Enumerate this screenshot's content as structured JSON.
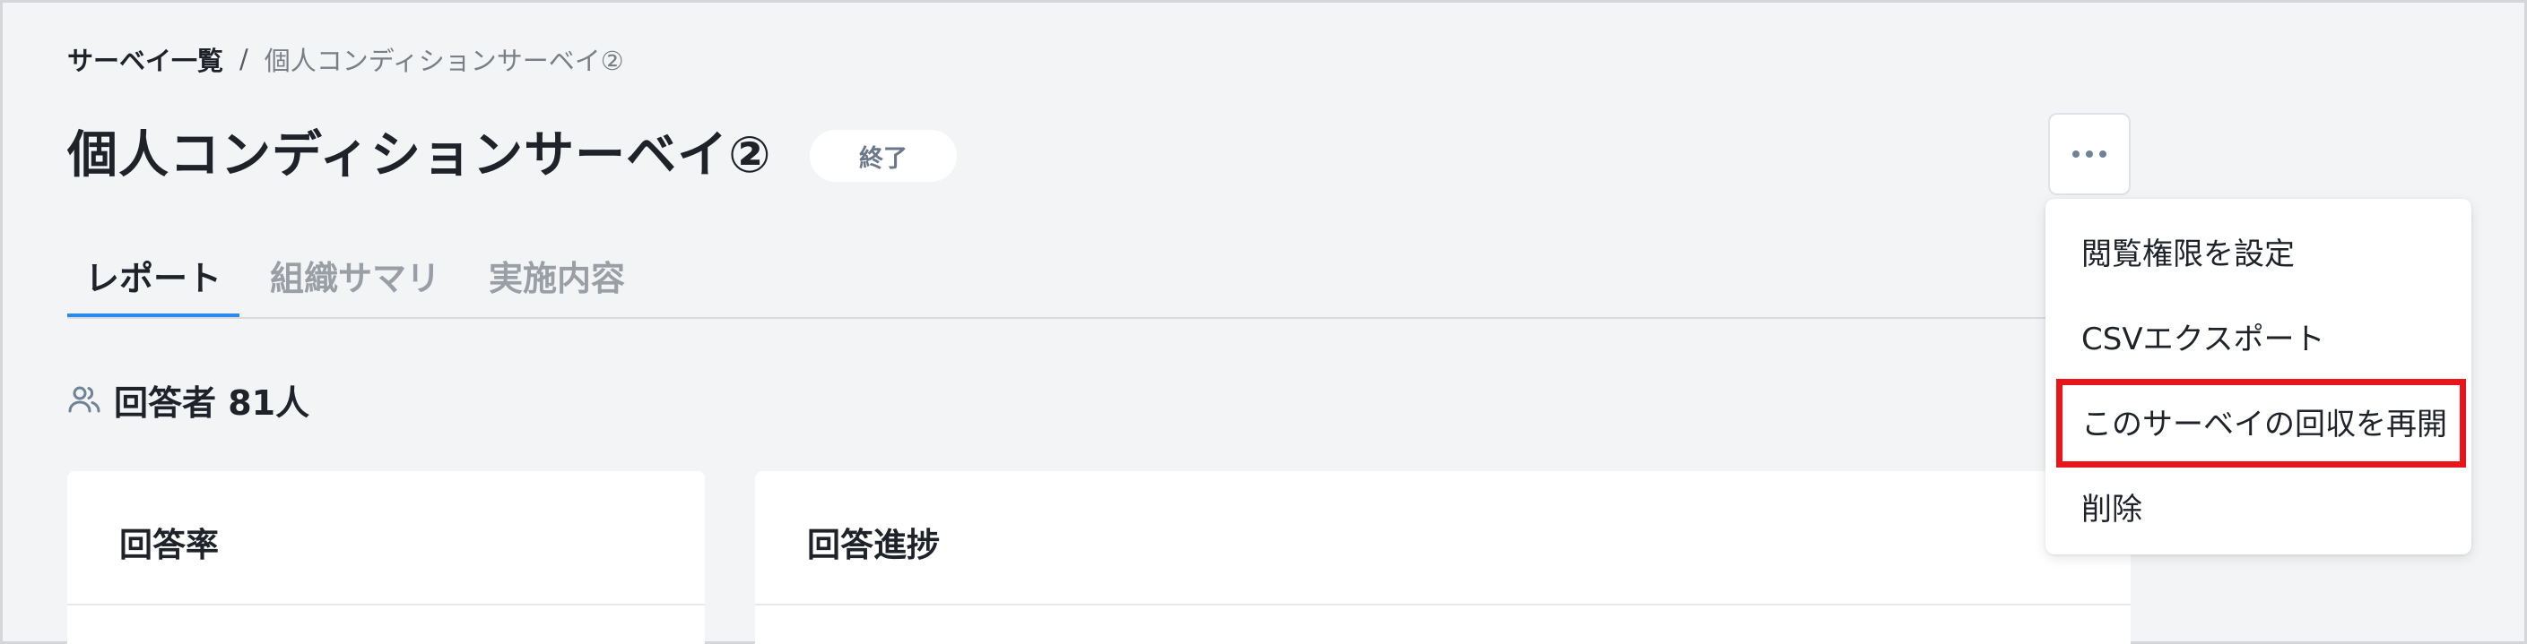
{
  "breadcrumb": {
    "root": "サーベイ一覧",
    "separator": "/",
    "current": "個人コンディションサーベイ②"
  },
  "header": {
    "title": "個人コンディションサーベイ②",
    "status": "終了",
    "more_icon": "ellipsis-icon"
  },
  "tabs": [
    {
      "label": "レポート",
      "active": true
    },
    {
      "label": "組織サマリ",
      "active": false
    },
    {
      "label": "実施内容",
      "active": false
    }
  ],
  "respondents": {
    "icon": "users-icon",
    "text": "回答者 81人"
  },
  "cards": {
    "rate_title": "回答率",
    "progress_title": "回答進捗"
  },
  "menu": {
    "items": [
      {
        "label": "閲覧権限を設定"
      },
      {
        "label": "CSVエクスポート"
      },
      {
        "label": "このサーベイの回収を再開",
        "highlighted": true
      },
      {
        "label": "削除"
      }
    ]
  },
  "colors": {
    "accent": "#2a8af0",
    "highlight": "#e8161b",
    "background": "#f3f4f6",
    "badge_text": "#6a7789"
  }
}
